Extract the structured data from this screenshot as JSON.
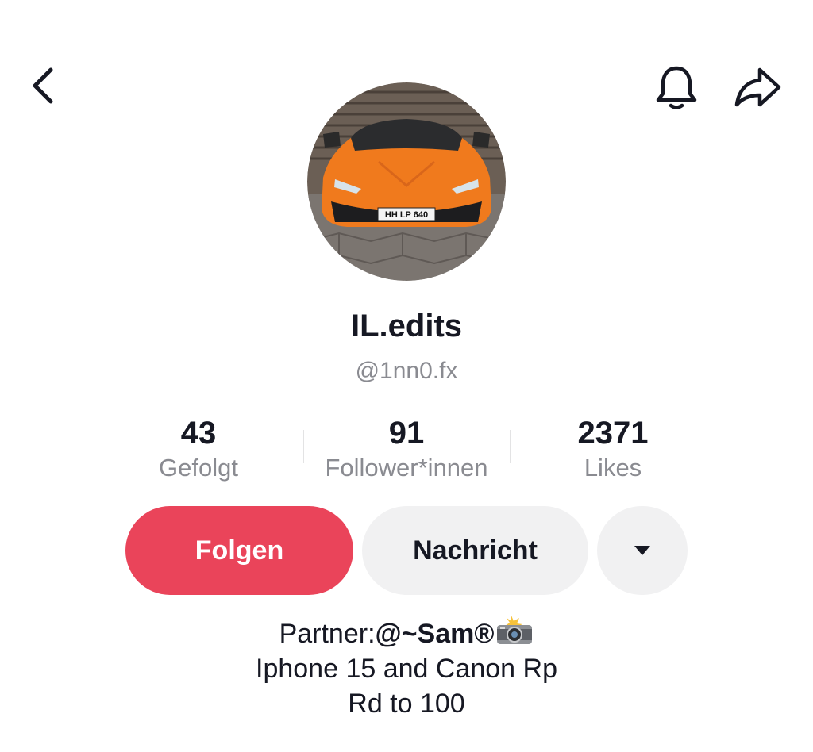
{
  "header": {
    "back_icon": "chevron-left-icon",
    "bell_icon": "bell-icon",
    "share_icon": "share-arrow-icon"
  },
  "profile": {
    "avatar": "orange-sports-car-photo",
    "display_name": "IL.edits",
    "username": "@1nn0.fx",
    "license_plate": "HH LP 640"
  },
  "stats": {
    "following": {
      "value": "43",
      "label": "Gefolgt"
    },
    "followers": {
      "value": "91",
      "label": "Follower*innen"
    },
    "likes": {
      "value": "2371",
      "label": "Likes"
    }
  },
  "actions": {
    "follow_label": "Folgen",
    "message_label": "Nachricht",
    "more_icon": "caret-down-icon"
  },
  "bio": {
    "partner_prefix": "Partner:",
    "partner_handle": "@~Sam®",
    "partner_icon": "camera-flash-icon",
    "line2": "Iphone 15 and Canon Rp",
    "line3": "Rd to 100"
  },
  "colors": {
    "accent": "#ea445a",
    "text_primary": "#161823",
    "text_secondary": "#8a8b91",
    "button_secondary": "#f1f1f2"
  }
}
